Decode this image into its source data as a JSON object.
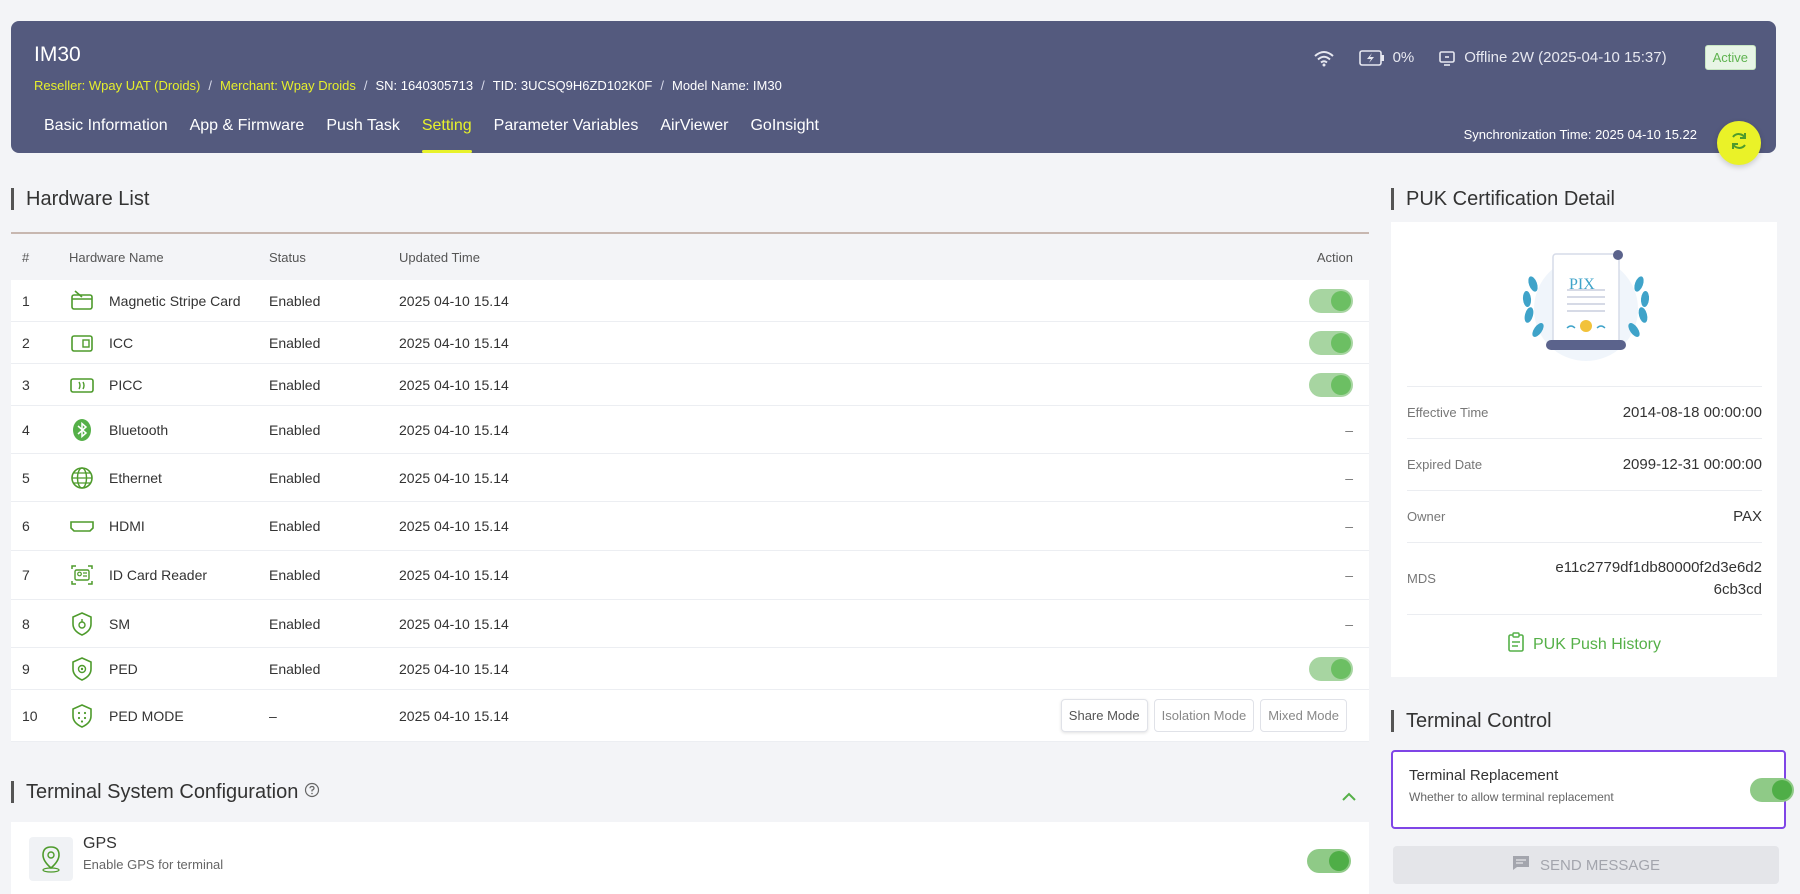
{
  "header": {
    "device_title": "IM30",
    "reseller": "Reseller: Wpay UAT (Droids)",
    "merchant": "Merchant: Wpay Droids",
    "sn": "SN: 1640305713",
    "tid": "TID: 3UCSQ9H6ZD102K0F",
    "model": "Model Name: IM30",
    "sep": "/",
    "battery": "0%",
    "offline": "Offline 2W (2025-04-10 15:37)",
    "active_badge": "Active",
    "sync_time": "Synchronization Time: 2025 04-10 15.22"
  },
  "tabs": [
    {
      "label": "Basic Information"
    },
    {
      "label": "App & Firmware"
    },
    {
      "label": "Push Task"
    },
    {
      "label": "Setting",
      "active": true
    },
    {
      "label": "Parameter Variables"
    },
    {
      "label": "AirViewer"
    },
    {
      "label": "GoInsight"
    }
  ],
  "hardware": {
    "title": "Hardware List",
    "columns": {
      "no": "#",
      "name": "Hardware Name",
      "status": "Status",
      "time": "Updated Time",
      "action": "Action"
    },
    "rows": [
      {
        "no": "1",
        "name": "Magnetic Stripe Card",
        "status": "Enabled",
        "time": "2025 04-10 15.14",
        "action": "toggle",
        "icon": "card-swipe-icon"
      },
      {
        "no": "2",
        "name": "ICC",
        "status": "Enabled",
        "time": "2025 04-10 15.14",
        "action": "toggle",
        "icon": "chip-card-icon"
      },
      {
        "no": "3",
        "name": "PICC",
        "status": "Enabled",
        "time": "2025 04-10 15.14",
        "action": "toggle",
        "icon": "contactless-icon"
      },
      {
        "no": "4",
        "name": "Bluetooth",
        "status": "Enabled",
        "time": "2025 04-10 15.14",
        "action": "dash",
        "icon": "bluetooth-icon"
      },
      {
        "no": "5",
        "name": "Ethernet",
        "status": "Enabled",
        "time": "2025 04-10 15.14",
        "action": "dash",
        "icon": "globe-icon"
      },
      {
        "no": "6",
        "name": "HDMI",
        "status": "Enabled",
        "time": "2025 04-10 15.14",
        "action": "dash",
        "icon": "hdmi-icon"
      },
      {
        "no": "7",
        "name": "ID Card Reader",
        "status": "Enabled",
        "time": "2025 04-10 15.14",
        "action": "dash",
        "icon": "id-card-icon"
      },
      {
        "no": "8",
        "name": "SM",
        "status": "Enabled",
        "time": "2025 04-10 15.14",
        "action": "dash",
        "icon": "shield-lock-icon"
      },
      {
        "no": "9",
        "name": "PED",
        "status": "Enabled",
        "time": "2025 04-10 15.14",
        "action": "toggle",
        "icon": "shield-icon"
      },
      {
        "no": "10",
        "name": "PED MODE",
        "status": "–",
        "time": "2025 04-10 15.14",
        "action": "modes",
        "icon": "shield-grid-icon"
      }
    ],
    "dash": "–",
    "modes": [
      "Share Mode",
      "Isolation Mode",
      "Mixed Mode"
    ]
  },
  "tsc": {
    "title": "Terminal System Configuration",
    "gps_title": "GPS",
    "gps_sub": "Enable GPS for terminal"
  },
  "puk": {
    "title": "PUK Certification Detail",
    "badge_text": "PIX",
    "rows": [
      {
        "k": "Effective Time",
        "v": "2014-08-18 00:00:00"
      },
      {
        "k": "Expired Date",
        "v": "2099-12-31 00:00:00"
      },
      {
        "k": "Owner",
        "v": "PAX"
      },
      {
        "k": "MDS",
        "v1": "e11c2779df1db80000f2d3e6d2",
        "v2": "6cb3cd"
      }
    ],
    "push_history": "PUK Push History"
  },
  "terminal_control": {
    "title": "Terminal Control",
    "replacement_title": "Terminal Replacement",
    "replacement_sub": "Whether to allow terminal replacement",
    "send_message": "SEND MESSAGE"
  },
  "colors": {
    "header_bg": "#545a7e",
    "accent_yellow": "#e8f22b",
    "green": "#55b048",
    "highlight_purple": "#7f45e6"
  }
}
